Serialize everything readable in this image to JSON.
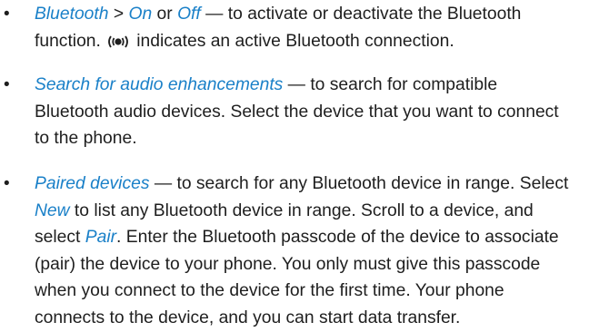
{
  "bullet_char": "•",
  "link_color": "#1a80c8",
  "text_color": "#1e1e1e",
  "items": [
    {
      "lines": [
        {
          "segs": [
            {
              "t": "Bluetooth",
              "link": true
            },
            {
              "t": " > ",
              "link": false
            },
            {
              "t": "On",
              "link": true
            },
            {
              "t": " or ",
              "link": false
            },
            {
              "t": "Off",
              "link": true
            },
            {
              "t": " — to activate or deactivate the Bluetooth",
              "link": false
            }
          ]
        },
        {
          "segs": [
            {
              "t": "function.",
              "link": false
            },
            {
              "icon": "bluetooth-active-icon"
            },
            {
              "t": " indicates an active Bluetooth connection.",
              "link": false
            }
          ]
        }
      ]
    },
    {
      "lines": [
        {
          "segs": [
            {
              "t": "Search for audio enhancements",
              "link": true
            },
            {
              "t": " — to search for compatible",
              "link": false
            }
          ]
        },
        {
          "segs": [
            {
              "t": "Bluetooth audio devices. Select the device that you want to connect",
              "link": false
            }
          ]
        },
        {
          "segs": [
            {
              "t": "to the phone.",
              "link": false
            }
          ]
        }
      ]
    },
    {
      "lines": [
        {
          "segs": [
            {
              "t": "Paired devices",
              "link": true
            },
            {
              "t": " — to search for any Bluetooth device in range. Select",
              "link": false
            }
          ]
        },
        {
          "segs": [
            {
              "t": "New",
              "link": true
            },
            {
              "t": " to list any Bluetooth device in range. Scroll to a device, and",
              "link": false
            }
          ]
        },
        {
          "segs": [
            {
              "t": "select ",
              "link": false
            },
            {
              "t": "Pair",
              "link": true
            },
            {
              "t": ". Enter the Bluetooth passcode of the device to associate",
              "link": false
            }
          ]
        },
        {
          "segs": [
            {
              "t": "(pair) the device to your phone. You only must give this passcode",
              "link": false
            }
          ]
        },
        {
          "segs": [
            {
              "t": "when you connect to the device for the first time. Your phone",
              "link": false
            }
          ]
        },
        {
          "segs": [
            {
              "t": "connects to the device, and you can start data transfer.",
              "link": false
            }
          ]
        }
      ]
    }
  ]
}
